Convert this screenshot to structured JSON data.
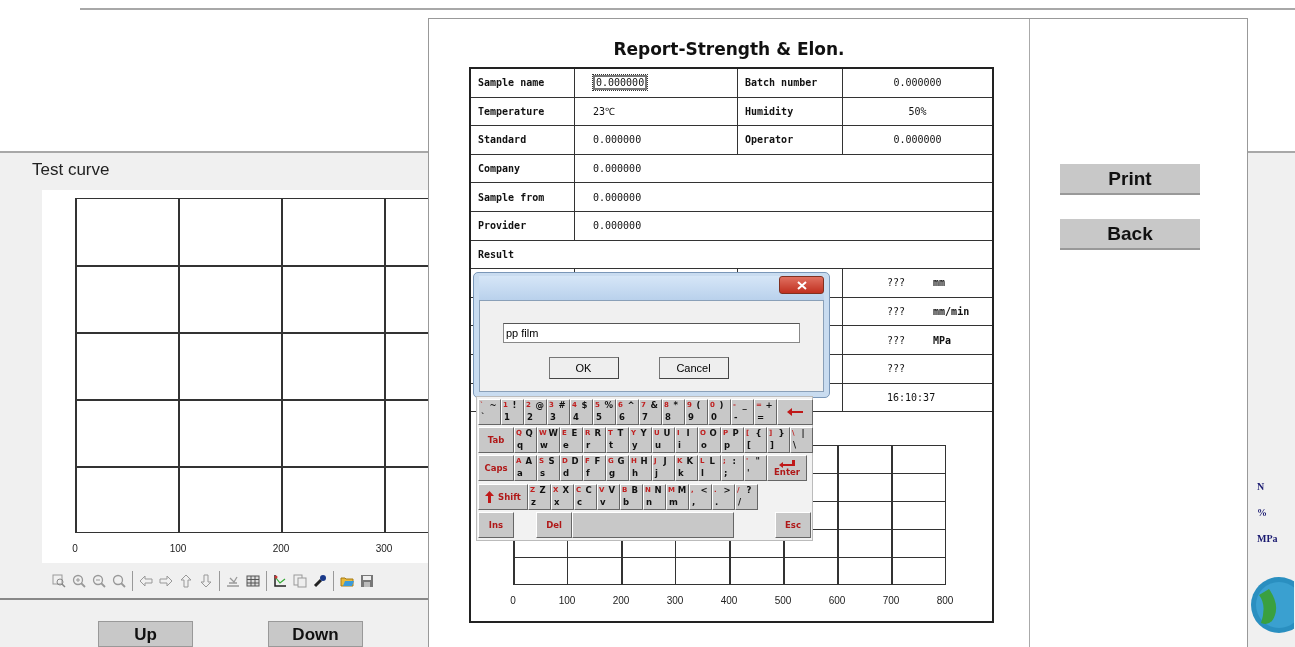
{
  "app": {
    "panel_title": "Test curve",
    "chart_x_labels": [
      "0",
      "100",
      "200",
      "300"
    ],
    "buttons": [
      "Up",
      "Down"
    ],
    "units": [
      "N",
      "%",
      "MPa"
    ]
  },
  "report": {
    "title": "Report-Strength & Elon.",
    "rows": [
      {
        "kind": "pair",
        "cells": [
          {
            "label": "Sample name",
            "value": "0.000000",
            "editing": true
          },
          {
            "label": "Batch number",
            "value": "0.000000",
            "editing": false
          }
        ]
      },
      {
        "kind": "pair",
        "cells": [
          {
            "label": "Temperature",
            "value": "23℃",
            "editing": false
          },
          {
            "label": "Humidity",
            "value": "50%",
            "editing": false
          }
        ]
      },
      {
        "kind": "pair",
        "cells": [
          {
            "label": "Standard",
            "value": "0.000000",
            "editing": false
          },
          {
            "label": "Operator",
            "value": "0.000000",
            "editing": false
          }
        ]
      },
      {
        "kind": "wide",
        "label": "Company",
        "value": "0.000000"
      },
      {
        "kind": "wide",
        "label": "Sample from",
        "value": "0.000000"
      },
      {
        "kind": "wide",
        "label": "Provider",
        "value": "0.000000"
      },
      {
        "kind": "heading",
        "label": "Result"
      },
      {
        "kind": "result",
        "value": "???",
        "unit": "mm"
      },
      {
        "kind": "result",
        "value": "???",
        "unit": "mm/min"
      },
      {
        "kind": "result",
        "value": "???",
        "unit": "MPa"
      },
      {
        "kind": "result",
        "value": "???"
      },
      {
        "kind": "result",
        "value": "16:10:37"
      }
    ],
    "chart_x_labels": [
      "0",
      "100",
      "200",
      "300",
      "400",
      "500",
      "600",
      "700",
      "800"
    ],
    "buttons": [
      "Print",
      "Back"
    ]
  },
  "dialog": {
    "input_value": "pp film",
    "buttons": [
      "OK",
      "Cancel"
    ]
  },
  "keyboard": {
    "rows": [
      [
        {
          "kind": "char",
          "mark": "`",
          "upper": "~",
          "lower": "`"
        },
        {
          "kind": "char",
          "mark": "1",
          "upper": "!",
          "lower": "1"
        },
        {
          "kind": "char",
          "mark": "2",
          "upper": "@",
          "lower": "2"
        },
        {
          "kind": "char",
          "mark": "3",
          "upper": "#",
          "lower": "3"
        },
        {
          "kind": "char",
          "mark": "4",
          "upper": "$",
          "lower": "4"
        },
        {
          "kind": "char",
          "mark": "5",
          "upper": "%",
          "lower": "5"
        },
        {
          "kind": "char",
          "mark": "6",
          "upper": "^",
          "lower": "6"
        },
        {
          "kind": "char",
          "mark": "7",
          "upper": "&",
          "lower": "7"
        },
        {
          "kind": "char",
          "mark": "8",
          "upper": "*",
          "lower": "8"
        },
        {
          "kind": "char",
          "mark": "9",
          "upper": "(",
          "lower": "9"
        },
        {
          "kind": "char",
          "mark": "0",
          "upper": ")",
          "lower": "0"
        },
        {
          "kind": "char",
          "mark": "-",
          "upper": "_",
          "lower": "-"
        },
        {
          "kind": "char",
          "mark": "=",
          "upper": "+",
          "lower": "="
        },
        {
          "kind": "backspace"
        }
      ],
      [
        {
          "kind": "wide",
          "label": "Tab"
        },
        {
          "kind": "char",
          "mark": "Q",
          "upper": "Q",
          "lower": "q"
        },
        {
          "kind": "char",
          "mark": "W",
          "upper": "W",
          "lower": "w"
        },
        {
          "kind": "char",
          "mark": "E",
          "upper": "E",
          "lower": "e"
        },
        {
          "kind": "char",
          "mark": "R",
          "upper": "R",
          "lower": "r"
        },
        {
          "kind": "char",
          "mark": "T",
          "upper": "T",
          "lower": "t"
        },
        {
          "kind": "char",
          "mark": "Y",
          "upper": "Y",
          "lower": "y"
        },
        {
          "kind": "char",
          "mark": "U",
          "upper": "U",
          "lower": "u"
        },
        {
          "kind": "char",
          "mark": "I",
          "upper": "I",
          "lower": "i"
        },
        {
          "kind": "char",
          "mark": "O",
          "upper": "O",
          "lower": "o"
        },
        {
          "kind": "char",
          "mark": "P",
          "upper": "P",
          "lower": "p"
        },
        {
          "kind": "char",
          "mark": "[",
          "upper": "{",
          "lower": "["
        },
        {
          "kind": "char",
          "mark": "]",
          "upper": "}",
          "lower": "]"
        },
        {
          "kind": "char",
          "mark": "\\",
          "upper": "|",
          "lower": "\\"
        }
      ],
      [
        {
          "kind": "wide",
          "label": "Caps"
        },
        {
          "kind": "char",
          "mark": "A",
          "upper": "A",
          "lower": "a"
        },
        {
          "kind": "char",
          "mark": "S",
          "upper": "S",
          "lower": "s"
        },
        {
          "kind": "char",
          "mark": "D",
          "upper": "D",
          "lower": "d"
        },
        {
          "kind": "char",
          "mark": "F",
          "upper": "F",
          "lower": "f"
        },
        {
          "kind": "char",
          "mark": "G",
          "upper": "G",
          "lower": "g"
        },
        {
          "kind": "char",
          "mark": "H",
          "upper": "H",
          "lower": "h"
        },
        {
          "kind": "char",
          "mark": "J",
          "upper": "J",
          "lower": "j"
        },
        {
          "kind": "char",
          "mark": "K",
          "upper": "K",
          "lower": "k"
        },
        {
          "kind": "char",
          "mark": "L",
          "upper": "L",
          "lower": "l"
        },
        {
          "kind": "char",
          "mark": ";",
          "upper": ":",
          "lower": ";"
        },
        {
          "kind": "char",
          "mark": "'",
          "upper": "\"",
          "lower": "'"
        },
        {
          "kind": "enter",
          "label": "Enter"
        }
      ],
      [
        {
          "kind": "shift",
          "label": "Shift"
        },
        {
          "kind": "char",
          "mark": "Z",
          "upper": "Z",
          "lower": "z"
        },
        {
          "kind": "char",
          "mark": "X",
          "upper": "X",
          "lower": "x"
        },
        {
          "kind": "char",
          "mark": "C",
          "upper": "C",
          "lower": "c"
        },
        {
          "kind": "char",
          "mark": "V",
          "upper": "V",
          "lower": "v"
        },
        {
          "kind": "char",
          "mark": "B",
          "upper": "B",
          "lower": "b"
        },
        {
          "kind": "char",
          "mark": "N",
          "upper": "N",
          "lower": "n"
        },
        {
          "kind": "char",
          "mark": "M",
          "upper": "M",
          "lower": "m"
        },
        {
          "kind": "char",
          "mark": ",",
          "upper": "<",
          "lower": ","
        },
        {
          "kind": "char",
          "mark": ".",
          "upper": ">",
          "lower": "."
        },
        {
          "kind": "char",
          "mark": "/",
          "upper": "?",
          "lower": "/"
        }
      ]
    ],
    "edit_keys": {
      "insert": "Ins",
      "delete": "Del",
      "escape": "Esc"
    }
  }
}
